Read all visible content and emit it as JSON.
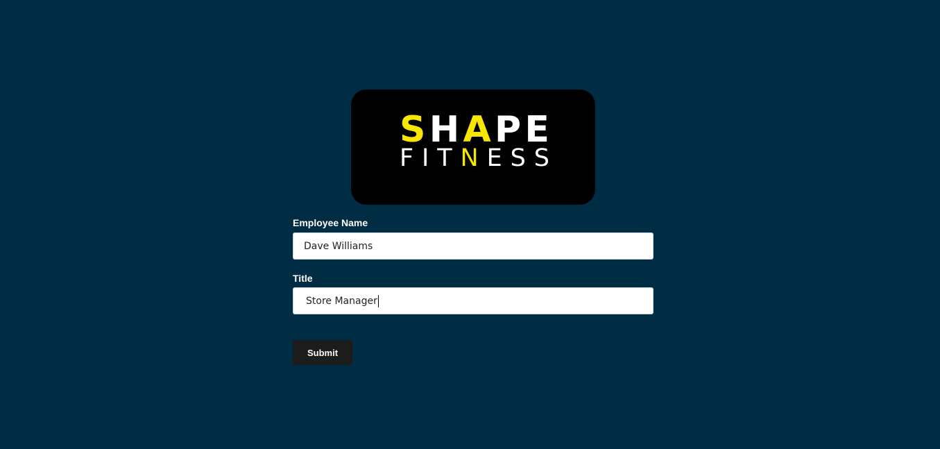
{
  "logo": {
    "line1": [
      "S",
      "H",
      "A",
      "P",
      "E"
    ],
    "line1_highlight": [
      0,
      2
    ],
    "line2": [
      "F",
      "I",
      "T",
      "N",
      "E",
      "S",
      "S"
    ],
    "line2_highlight": [
      3
    ]
  },
  "form": {
    "employee_name_label": "Employee Name",
    "employee_name_value": "Dave Williams",
    "title_label": "Title",
    "title_value": "Store Manager",
    "submit_label": "Submit"
  },
  "colors": {
    "background": "#002d44",
    "logo_background": "#000000",
    "logo_accent": "#f6e600",
    "button_background": "#1c1c1c"
  }
}
